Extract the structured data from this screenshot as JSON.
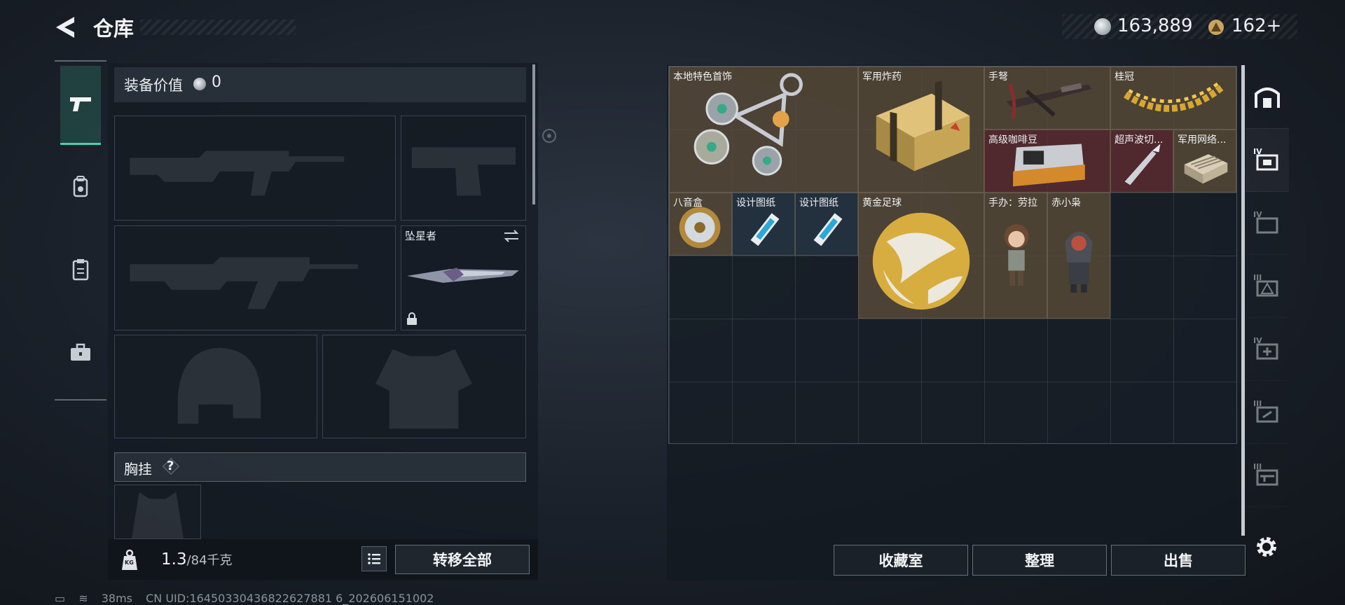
{
  "header": {
    "title": "仓库",
    "currency_main": "163,889",
    "currency_secondary": "162+",
    "currency_main_icon": "silver-coin-icon",
    "currency_secondary_icon": "gold-triangle-coin-icon"
  },
  "left_tabs": [
    {
      "name": "pistol-icon",
      "active": true
    },
    {
      "name": "backpack-icon",
      "active": false
    },
    {
      "name": "clipboard-icon",
      "active": false
    },
    {
      "name": "toolbox-icon",
      "active": false
    }
  ],
  "loadout": {
    "equip_value_label": "装备价值",
    "equip_value": "0",
    "knife_name": "坠星者",
    "chest_label": "胸挂",
    "chest_help": "?",
    "weight_current": "1.3",
    "weight_max": "/84千克",
    "transfer_all": "转移全部",
    "weight_icon": "KG"
  },
  "storage": {
    "items": [
      {
        "name": "本地特色首饰",
        "rarity": "gold"
      },
      {
        "name": "军用炸药",
        "rarity": "gold"
      },
      {
        "name": "手弩",
        "rarity": "gold"
      },
      {
        "name": "桂冠",
        "rarity": "gold"
      },
      {
        "name": "高级咖啡豆",
        "rarity": "red"
      },
      {
        "name": "超声波切...",
        "rarity": "red"
      },
      {
        "name": "军用网络...",
        "rarity": "gold"
      },
      {
        "name": "八音盒",
        "rarity": "gold"
      },
      {
        "name": "设计图纸",
        "rarity": "blue"
      },
      {
        "name": "设计图纸",
        "rarity": "blue"
      },
      {
        "name": "黄金足球",
        "rarity": "gold"
      },
      {
        "name": "手办：劳拉",
        "rarity": "gold"
      },
      {
        "name": "赤小枭",
        "rarity": "gold"
      }
    ],
    "buttons": {
      "collection": "收藏室",
      "organize": "整理",
      "sell": "出售"
    }
  },
  "right_tabs": [
    {
      "name": "vault-icon",
      "tier": ""
    },
    {
      "name": "storage-box-icon",
      "tier": "IV"
    },
    {
      "name": "folder-box-icon",
      "tier": "IV"
    },
    {
      "name": "warning-box-icon",
      "tier": "III"
    },
    {
      "name": "medical-box-icon",
      "tier": "IV"
    },
    {
      "name": "tool-box-icon",
      "tier": "III"
    },
    {
      "name": "rifle-box-icon",
      "tier": "III"
    }
  ],
  "status": {
    "ping": "38ms",
    "uid": "CN UID:16450330436822627881 6_202606151002"
  },
  "colors": {
    "accent": "#3fd4b0",
    "gold_rarity": "#5a4a38",
    "red_rarity": "#5c2c30"
  }
}
